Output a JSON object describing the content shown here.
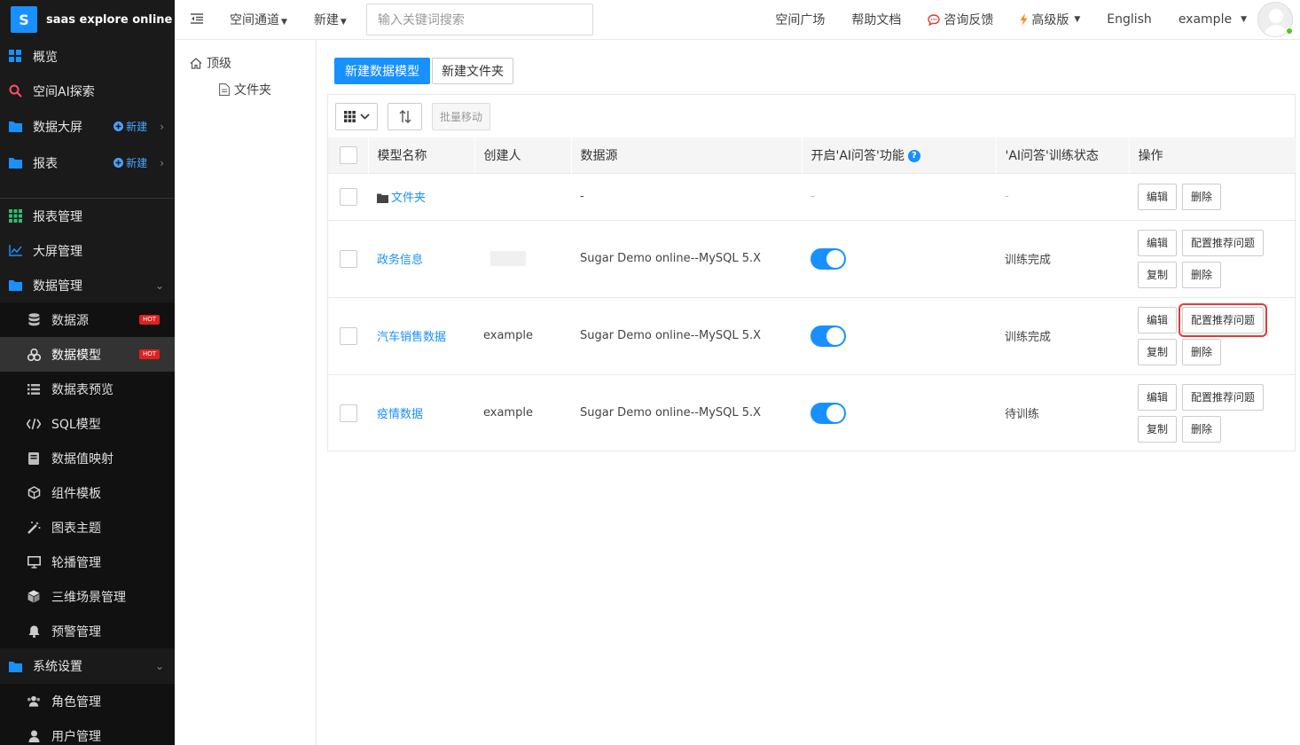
{
  "brand": {
    "logo_letter": "S",
    "name": "saas explore online"
  },
  "sidebar": {
    "top_items": [
      {
        "label": "概览",
        "icon": "grid-icon"
      },
      {
        "label": "空间AI探索",
        "icon": "search-icon"
      },
      {
        "label": "数据大屏",
        "icon": "folder-icon",
        "new_label": "新建"
      },
      {
        "label": "报表",
        "icon": "folder-icon",
        "new_label": "新建"
      }
    ],
    "mid_items": [
      {
        "label": "报表管理",
        "icon": "table-grid-icon"
      },
      {
        "label": "大屏管理",
        "icon": "line-chart-icon"
      },
      {
        "label": "数据管理",
        "icon": "folder-icon"
      }
    ],
    "data_sub": [
      {
        "label": "数据源",
        "icon": "database-icon",
        "badge": "HOT"
      },
      {
        "label": "数据模型",
        "icon": "model-icon",
        "badge": "HOT"
      },
      {
        "label": "数据表预览",
        "icon": "list-icon"
      },
      {
        "label": "SQL模型",
        "icon": "code-icon"
      },
      {
        "label": "数据值映射",
        "icon": "book-icon"
      },
      {
        "label": "组件模板",
        "icon": "cube-outline-icon"
      },
      {
        "label": "图表主题",
        "icon": "magic-wand-icon"
      },
      {
        "label": "轮播管理",
        "icon": "monitor-icon"
      },
      {
        "label": "三维场景管理",
        "icon": "cube-icon"
      },
      {
        "label": "预警管理",
        "icon": "bell-icon"
      }
    ],
    "settings": {
      "label": "系统设置",
      "icon": "folder-icon"
    },
    "settings_sub": [
      {
        "label": "角色管理",
        "icon": "users-icon"
      },
      {
        "label": "用户管理",
        "icon": "user-icon"
      }
    ]
  },
  "topbar": {
    "menu_space": "空间通道",
    "menu_new": "新建",
    "search_placeholder": "输入关键词搜索",
    "right_links": [
      "空间广场",
      "帮助文档",
      "咨询反馈",
      "高级版",
      "English",
      "example"
    ]
  },
  "tree": {
    "root": "顶级",
    "child": "文件夹"
  },
  "main": {
    "new_model_btn": "新建数据模型",
    "new_folder_btn": "新建文件夹",
    "batch_move": "批量移动",
    "columns": [
      "模型名称",
      "创建人",
      "数据源",
      "开启'AI问答'功能",
      "'AI问答'训练状态",
      "操作"
    ],
    "folder_row": {
      "name": "文件夹",
      "datasource": "-",
      "ai_enabled": "-",
      "ai_status": "-",
      "ops": [
        "编辑",
        "删除"
      ]
    },
    "rows": [
      {
        "name": "政务信息",
        "creator": "",
        "datasource": "Sugar Demo online--MySQL 5.X",
        "ai_status": "训练完成",
        "ops": [
          "编辑",
          "配置推荐问题",
          "复制",
          "删除"
        ]
      },
      {
        "name": "汽车销售数据",
        "creator": "example",
        "datasource": "Sugar Demo online--MySQL 5.X",
        "ai_status": "训练完成",
        "ops": [
          "编辑",
          "配置推荐问题",
          "复制",
          "删除"
        ]
      },
      {
        "name": "疫情数据",
        "creator": "example",
        "datasource": "Sugar Demo online--MySQL 5.X",
        "ai_status": "待训练",
        "ops": [
          "编辑",
          "配置推荐问题",
          "复制",
          "删除"
        ]
      }
    ]
  },
  "colors": {
    "accent": "#1890ff",
    "sidebar_bg": "#1a1a1a",
    "hot_badge": "#e02020",
    "highlight": "#e53935"
  }
}
